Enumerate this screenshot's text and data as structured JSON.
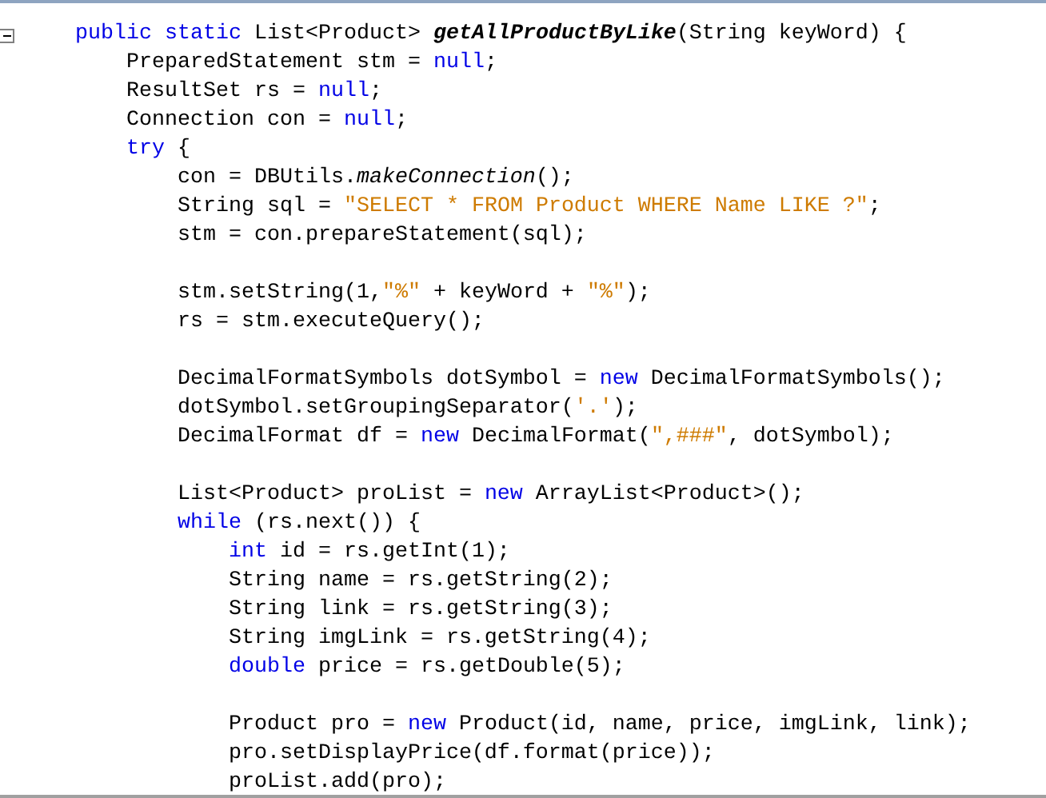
{
  "editor": {
    "fold_marker": {
      "expanded": true
    },
    "lines": [
      {
        "kind": "code",
        "tokens": [
          {
            "kind": "keyword",
            "text": "    public static"
          },
          {
            "kind": "plain",
            "text": " List<Product> "
          },
          {
            "kind": "method_decl",
            "text": "getAllProductByLike"
          },
          {
            "kind": "plain",
            "text": "(String keyWord) {"
          }
        ]
      },
      {
        "kind": "code",
        "tokens": [
          {
            "kind": "plain",
            "text": "        PreparedStatement stm = "
          },
          {
            "kind": "keyword",
            "text": "null"
          },
          {
            "kind": "plain",
            "text": ";"
          }
        ]
      },
      {
        "kind": "code",
        "tokens": [
          {
            "kind": "plain",
            "text": "        ResultSet rs = "
          },
          {
            "kind": "keyword",
            "text": "null"
          },
          {
            "kind": "plain",
            "text": ";"
          }
        ]
      },
      {
        "kind": "code",
        "tokens": [
          {
            "kind": "plain",
            "text": "        Connection con = "
          },
          {
            "kind": "keyword",
            "text": "null"
          },
          {
            "kind": "plain",
            "text": ";"
          }
        ]
      },
      {
        "kind": "code",
        "tokens": [
          {
            "kind": "keyword",
            "text": "        try"
          },
          {
            "kind": "plain",
            "text": " {"
          }
        ]
      },
      {
        "kind": "code",
        "tokens": [
          {
            "kind": "plain",
            "text": "            con = DBUtils."
          },
          {
            "kind": "static_call",
            "text": "makeConnection"
          },
          {
            "kind": "plain",
            "text": "();"
          }
        ]
      },
      {
        "kind": "code",
        "tokens": [
          {
            "kind": "plain",
            "text": "            String sql = "
          },
          {
            "kind": "string",
            "text": "\"SELECT * FROM Product WHERE Name LIKE ?\""
          },
          {
            "kind": "plain",
            "text": ";"
          }
        ]
      },
      {
        "kind": "code",
        "tokens": [
          {
            "kind": "plain",
            "text": "            stm = con.prepareStatement(sql);"
          }
        ]
      },
      {
        "kind": "blank"
      },
      {
        "kind": "code",
        "tokens": [
          {
            "kind": "plain",
            "text": "            stm.setString(1,"
          },
          {
            "kind": "string",
            "text": "\"%\""
          },
          {
            "kind": "plain",
            "text": " + keyWord + "
          },
          {
            "kind": "string",
            "text": "\"%\""
          },
          {
            "kind": "plain",
            "text": ");"
          }
        ]
      },
      {
        "kind": "code",
        "tokens": [
          {
            "kind": "plain",
            "text": "            rs = stm.executeQuery();"
          }
        ]
      },
      {
        "kind": "blank"
      },
      {
        "kind": "code",
        "tokens": [
          {
            "kind": "plain",
            "text": "            DecimalFormatSymbols dotSymbol = "
          },
          {
            "kind": "keyword",
            "text": "new"
          },
          {
            "kind": "plain",
            "text": " DecimalFormatSymbols();"
          }
        ]
      },
      {
        "kind": "code",
        "tokens": [
          {
            "kind": "plain",
            "text": "            dotSymbol.setGroupingSeparator("
          },
          {
            "kind": "string",
            "text": "'.'"
          },
          {
            "kind": "plain",
            "text": ");"
          }
        ]
      },
      {
        "kind": "code",
        "tokens": [
          {
            "kind": "plain",
            "text": "            DecimalFormat df = "
          },
          {
            "kind": "keyword",
            "text": "new"
          },
          {
            "kind": "plain",
            "text": " DecimalFormat("
          },
          {
            "kind": "string",
            "text": "\",###\""
          },
          {
            "kind": "plain",
            "text": ", dotSymbol);"
          }
        ]
      },
      {
        "kind": "blank"
      },
      {
        "kind": "code",
        "tokens": [
          {
            "kind": "plain",
            "text": "            List<Product> proList = "
          },
          {
            "kind": "keyword",
            "text": "new"
          },
          {
            "kind": "plain",
            "text": " ArrayList<Product>();"
          }
        ]
      },
      {
        "kind": "code",
        "tokens": [
          {
            "kind": "keyword",
            "text": "            while"
          },
          {
            "kind": "plain",
            "text": " (rs.next()) {"
          }
        ]
      },
      {
        "kind": "code",
        "tokens": [
          {
            "kind": "keyword",
            "text": "                int"
          },
          {
            "kind": "plain",
            "text": " id = rs.getInt(1);"
          }
        ]
      },
      {
        "kind": "code",
        "tokens": [
          {
            "kind": "plain",
            "text": "                String name = rs.getString(2);"
          }
        ]
      },
      {
        "kind": "code",
        "tokens": [
          {
            "kind": "plain",
            "text": "                String link = rs.getString(3);"
          }
        ]
      },
      {
        "kind": "code",
        "tokens": [
          {
            "kind": "plain",
            "text": "                String imgLink = rs.getString(4);"
          }
        ]
      },
      {
        "kind": "code",
        "tokens": [
          {
            "kind": "keyword",
            "text": "                double"
          },
          {
            "kind": "plain",
            "text": " price = rs.getDouble(5);"
          }
        ]
      },
      {
        "kind": "blank"
      },
      {
        "kind": "code",
        "tokens": [
          {
            "kind": "plain",
            "text": "                Product pro = "
          },
          {
            "kind": "keyword",
            "text": "new"
          },
          {
            "kind": "plain",
            "text": " Product(id, name, price, imgLink, link);"
          }
        ]
      },
      {
        "kind": "code",
        "tokens": [
          {
            "kind": "plain",
            "text": "                pro.setDisplayPrice(df.format(price));"
          }
        ]
      },
      {
        "kind": "code",
        "tokens": [
          {
            "kind": "plain",
            "text": "                proList.add(pro);"
          }
        ]
      }
    ]
  }
}
